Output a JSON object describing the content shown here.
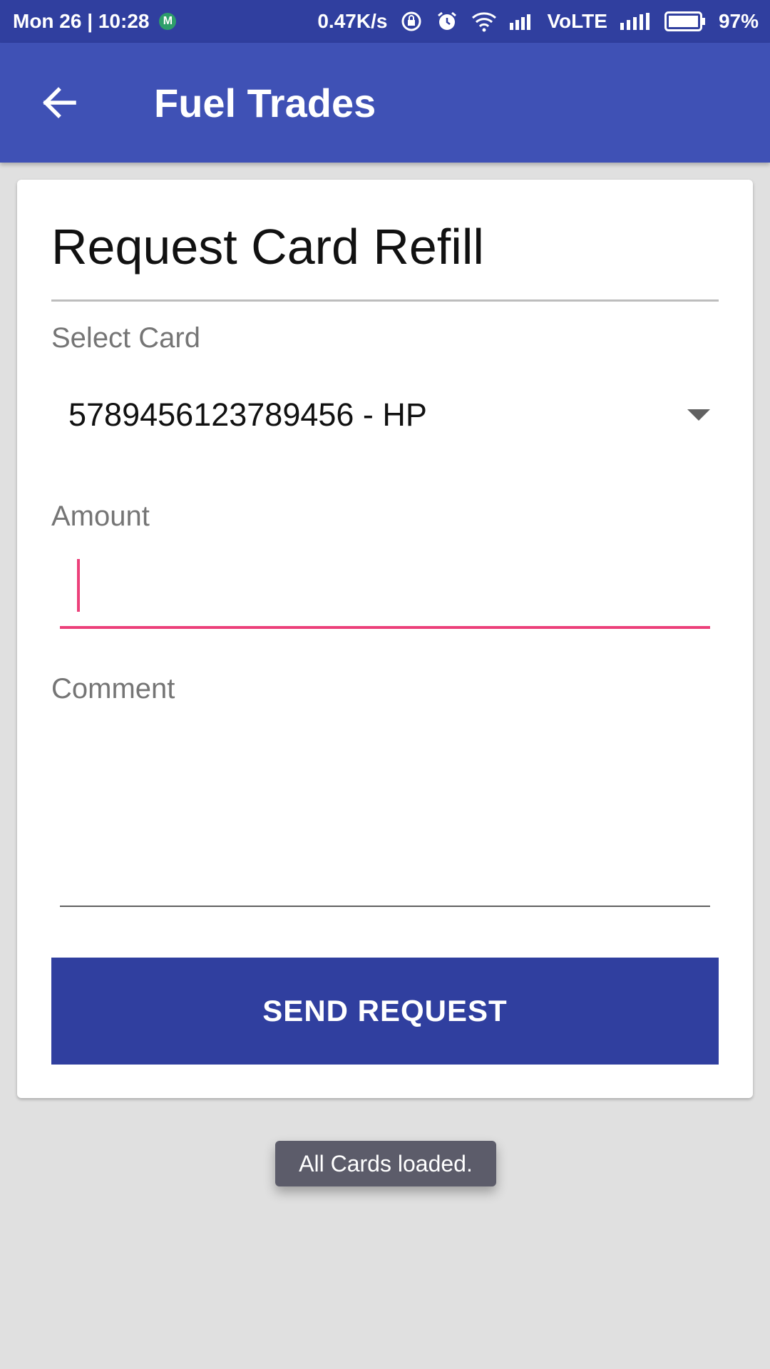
{
  "status_bar": {
    "time": "Mon 26 | 10:28",
    "notification_badge": "M",
    "net_speed": "0.47K/s",
    "network_label": "VoLTE",
    "battery": "97%"
  },
  "app_bar": {
    "title": "Fuel Trades",
    "back_icon": "arrow-left-icon"
  },
  "form": {
    "title": "Request Card Refill",
    "select_card_label": "Select Card",
    "selected_card": "5789456123789456 - HP",
    "amount_label": "Amount",
    "amount_value": "",
    "comment_label": "Comment",
    "comment_value": "",
    "submit_label": "SEND REQUEST"
  },
  "toast": {
    "message": "All Cards loaded."
  },
  "colors": {
    "status_bar": "#303f9f",
    "app_bar": "#3f51b5",
    "accent": "#ec407a",
    "button": "#303f9f",
    "background": "#e0e0e0"
  }
}
